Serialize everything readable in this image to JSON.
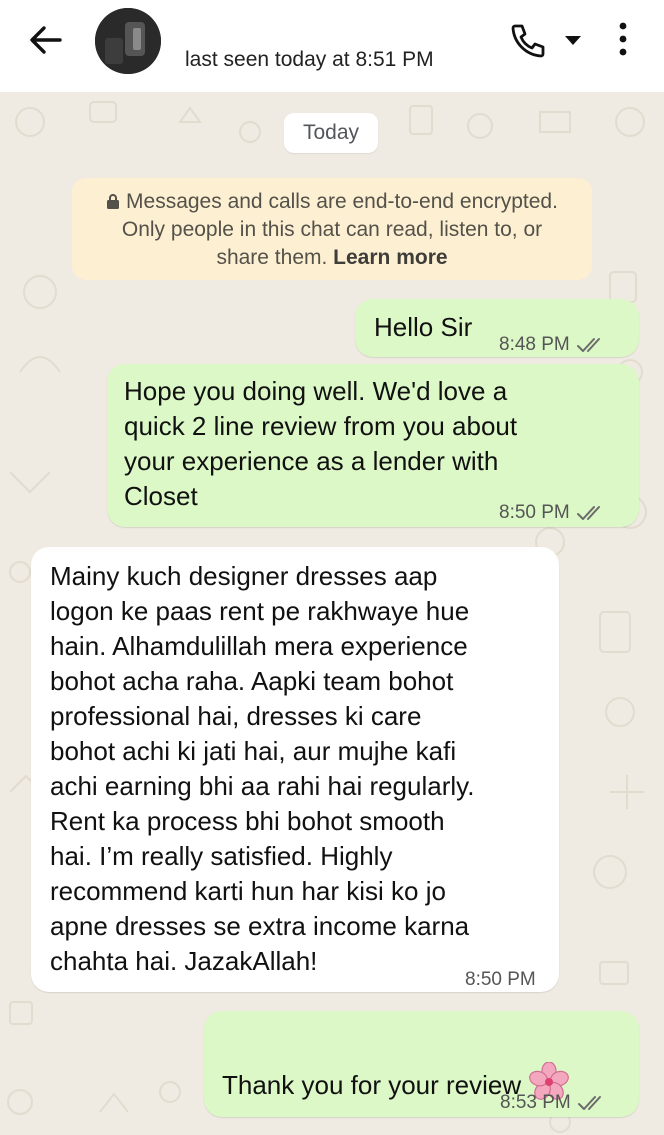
{
  "header": {
    "status": "last seen today at 8:51 PM"
  },
  "chat": {
    "date_chip": "Today",
    "encryption_notice": {
      "text": "Messages and calls are end-to-end encrypted. Only people in this chat can read, listen to, or share them.",
      "link": "Learn more"
    },
    "messages": [
      {
        "direction": "outgoing",
        "text": "Hello Sir",
        "time": "8:48 PM",
        "read": true
      },
      {
        "direction": "outgoing",
        "text": "Hope you doing well. We'd love a\nquick 2 line review from you about\nyour experience as a lender with\nCloset",
        "time": "8:50 PM",
        "read": true
      },
      {
        "direction": "incoming",
        "text": "Mainy kuch designer dresses aap\nlogon ke paas rent pe rakhwaye hue\nhain. Alhamdulillah mera experience\nbohot acha raha. Aapki team bohot\nprofessional hai, dresses ki care\nbohot achi ki jati hai, aur mujhe kafi\nachi earning bhi aa rahi hai regularly.\nRent ka process bhi bohot smooth\nhai. I’m really satisfied. Highly\nrecommend karti hun har kisi ko jo\napne dresses se extra income karna\nchahta hai. JazakAllah!",
        "time": "8:50 PM",
        "read": null
      },
      {
        "direction": "outgoing",
        "text": "Thank you for your review",
        "time": "8:53 PM",
        "read": true,
        "emoji": "cherry-blossom"
      }
    ]
  },
  "colors": {
    "outgoing_bubble": "#dcf8c6",
    "incoming_bubble": "#ffffff",
    "chat_background": "#efeae2",
    "encryption_notice_bg": "#fdf0d2",
    "read_ticks": "#6b6b6b"
  },
  "icons": {
    "back": "arrow-left-icon",
    "call": "phone-icon",
    "dropdown": "caret-down-icon",
    "menu": "vertical-dots-icon",
    "lock": "lock-icon",
    "read": "double-check-icon"
  }
}
